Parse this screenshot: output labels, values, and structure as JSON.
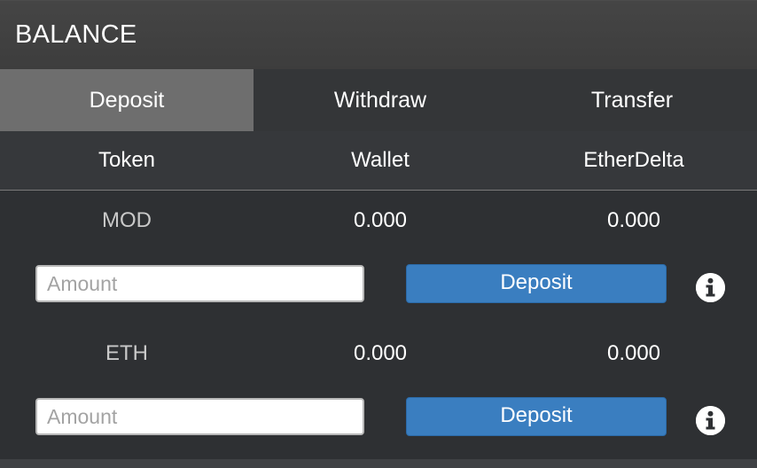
{
  "header": {
    "title": "BALANCE"
  },
  "tabs": [
    {
      "label": "Deposit",
      "active": true
    },
    {
      "label": "Withdraw",
      "active": false
    },
    {
      "label": "Transfer",
      "active": false
    }
  ],
  "columns": [
    "Token",
    "Wallet",
    "EtherDelta"
  ],
  "rows": [
    {
      "token": "MOD",
      "wallet": "0.000",
      "etherdelta": "0.000",
      "amount_placeholder": "Amount",
      "amount_value": "",
      "button_label": "Deposit",
      "info_icon": "info-circle-icon"
    },
    {
      "token": "ETH",
      "wallet": "0.000",
      "etherdelta": "0.000",
      "amount_placeholder": "Amount",
      "amount_value": "",
      "button_label": "Deposit",
      "info_icon": "info-circle-icon"
    }
  ],
  "colors": {
    "active_tab": "#6e6e6e",
    "button": "#3a7ec0",
    "background": "#2e3033"
  }
}
